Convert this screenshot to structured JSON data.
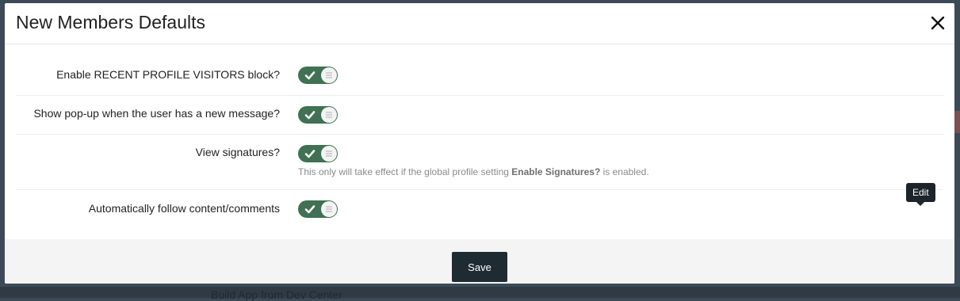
{
  "modal": {
    "title": "New Members Defaults",
    "close_icon": "close-icon"
  },
  "settings": [
    {
      "label": "Enable RECENT PROFILE VISITORS block?",
      "enabled": true
    },
    {
      "label": "Show pop-up when the user has a new message?",
      "enabled": true
    },
    {
      "label": "View signatures?",
      "enabled": true,
      "hint_prefix": "This only will take effect if the global profile setting ",
      "hint_bold": "Enable Signatures?",
      "hint_suffix": " is enabled."
    },
    {
      "label": "Automatically follow content/comments",
      "enabled": true
    }
  ],
  "footer": {
    "save_label": "Save"
  },
  "tooltip": {
    "text": "Edit"
  },
  "background": {
    "text": "Build App from Dev Center"
  },
  "colors": {
    "toggle_on": "#3f7152",
    "save_button": "#1f2b33",
    "tooltip": "#1d242b"
  }
}
